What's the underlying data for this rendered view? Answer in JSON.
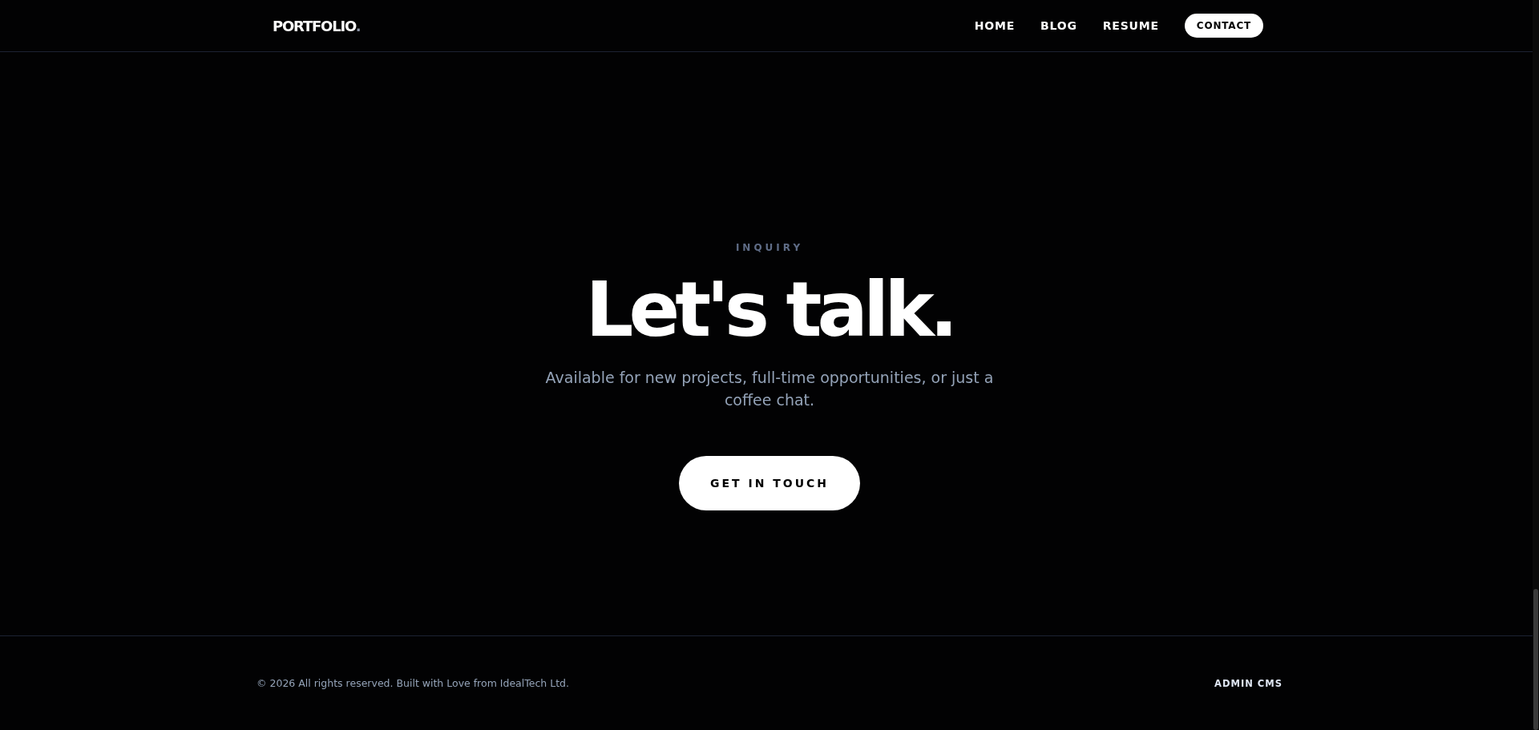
{
  "header": {
    "logo": {
      "name": "PORTFOLIO",
      "dot": "."
    },
    "nav": [
      {
        "label": "HOME",
        "kind": "link"
      },
      {
        "label": "BLOG",
        "kind": "link"
      },
      {
        "label": "RESUME",
        "kind": "link"
      },
      {
        "label": "CONTACT",
        "kind": "pill"
      }
    ]
  },
  "hero": {
    "eyebrow": "INQUIRY",
    "title": "Let's talk.",
    "text": "Available for new projects, full-time opportunities, or just a coffee chat.",
    "button": "GET IN TOUCH"
  },
  "footer": {
    "copyright": "© 2026 All rights reserved. Built with Love from IdealTech Ltd.",
    "link": "ADMIN CMS"
  }
}
